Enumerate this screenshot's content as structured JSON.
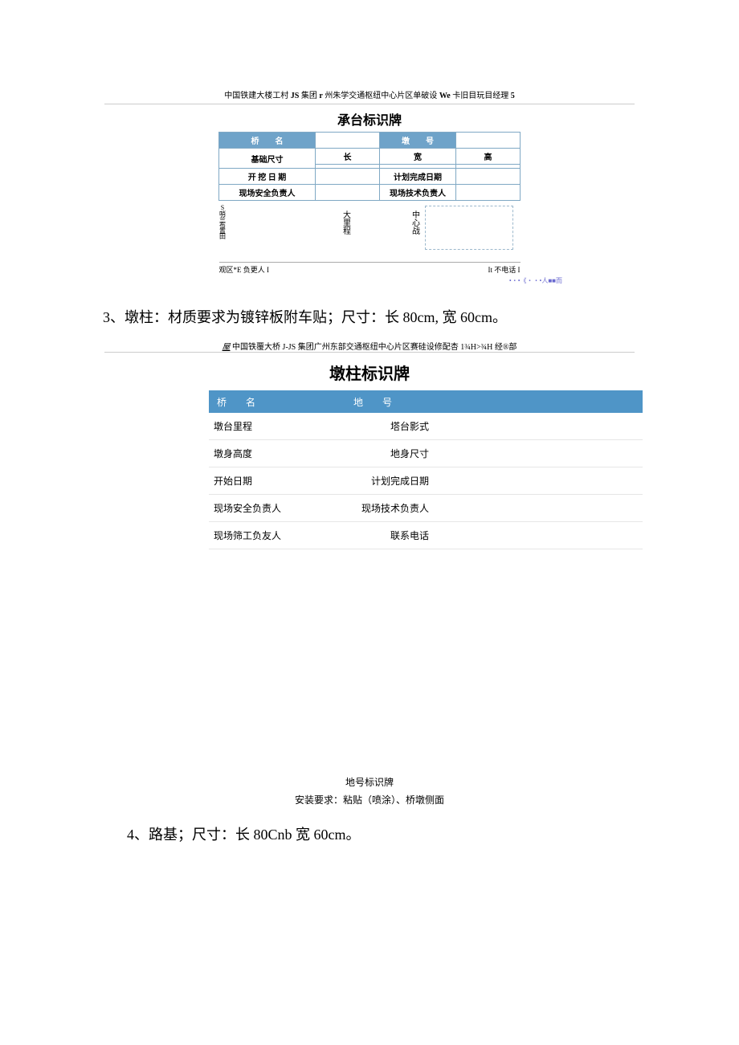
{
  "header1": {
    "prefix": "中国铁建大楼工村 ",
    "bold1": "JS",
    "mid1": " 集团 ",
    "bold2": "r",
    "mid2": " 州朱学交通枢纽中心片区单破设 ",
    "bold3": "We",
    "mid3": " 卡旧目玩目经理 ",
    "bold4": "5"
  },
  "table1": {
    "title": "承台标识牌",
    "row1": {
      "c1": "桥　　名",
      "c3": "墩　　号"
    },
    "row2": {
      "c1": "基础尺寸",
      "c2": "长",
      "c3": "宽",
      "c4": "高"
    },
    "row3": {
      "c1": "开 挖 日 期",
      "c3": "计划完成日期"
    },
    "row4": {
      "c1": "现场安全负责人",
      "c3": "现场技术负责人"
    },
    "diag": {
      "left": "S哨兰布置田",
      "mid": "大里程",
      "center": "中心战"
    },
    "under": {
      "left": "观区*E 负更人 I",
      "right": "It 不电话 I"
    },
    "tiny": "•・•《・・•人■■而"
  },
  "bodytext3": "3、墩柱：材质要求为镀锌板附车贴；尺寸：长 80cm, 宽 60cm。",
  "header2": {
    "italic": "屋",
    "text1": " 中国铁覆大桥 ",
    "b1": "J-JS",
    "text2": " 集团广州东部交通枢纽中心片区赛硅设修配杏 ",
    "b2": "1¾H>¾H",
    "text3": " 经®部"
  },
  "table2": {
    "title": "墩柱标识牌",
    "header": {
      "h1": "桥名",
      "h2": "地号"
    },
    "rows": [
      {
        "l1": "墩台里程",
        "l2": "塔台影式"
      },
      {
        "l1": "墩身高度",
        "l2": "地身尺寸"
      },
      {
        "l1": "开始日期",
        "l2": "计划完成日期"
      },
      {
        "l1": "现场安全负责人",
        "l2": "现场技术负责人"
      },
      {
        "l1": "现场筛工负友人",
        "l2": "联系电话"
      }
    ]
  },
  "bottom": {
    "line1": "地号标识牌",
    "line2": "安装要求：粘贴（喷涂）、桥墩侧面"
  },
  "bodytext4": "4、路基；尺寸：长 80Cnb 宽 60cm。"
}
